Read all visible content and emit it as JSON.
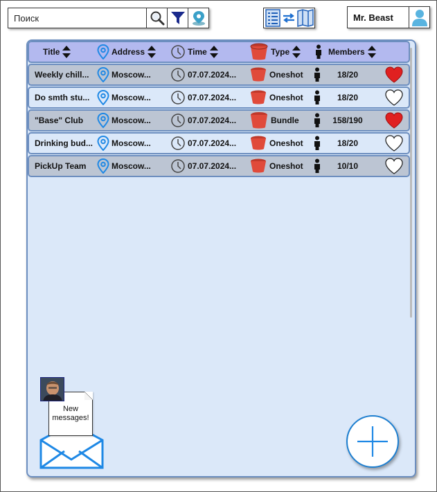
{
  "search": {
    "placeholder": "Поиск"
  },
  "user": {
    "name": "Mr. Beast"
  },
  "table": {
    "headers": {
      "title": "Title",
      "address": "Address",
      "time": "Time",
      "type": "Type",
      "members": "Members"
    },
    "rows": [
      {
        "title": "Weekly chill...",
        "address": "Moscow...",
        "time": "07.07.2024...",
        "type": "Oneshot",
        "members": "18/20",
        "favorite": true
      },
      {
        "title": "Do smth stu...",
        "address": "Moscow...",
        "time": "07.07.2024...",
        "type": "Oneshot",
        "members": "18/20",
        "favorite": false
      },
      {
        "title": "\"Base\" Club",
        "address": "Moscow...",
        "time": "07.07.2024...",
        "type": "Bundle",
        "members": "158/190",
        "favorite": true
      },
      {
        "title": "Drinking bud...",
        "address": "Moscow...",
        "time": "07.07.2024...",
        "type": "Oneshot",
        "members": "18/20",
        "favorite": false
      },
      {
        "title": "PickUp Team",
        "address": "Moscow...",
        "time": "07.07.2024...",
        "type": "Oneshot",
        "members": "10/10",
        "favorite": false
      }
    ]
  },
  "messages": {
    "line1": "New",
    "line2": "messages!"
  },
  "icons": {
    "search": "magnifier-icon",
    "filter": "funnel-icon",
    "location": "map-pin-icon",
    "list_view": "list-view-icon",
    "switch": "swap-arrows-icon",
    "map_view": "map-view-icon",
    "avatar": "user-avatar-icon",
    "sort": "sort-arrows-icon",
    "clock": "clock-icon",
    "type": "bucket-icon",
    "member": "person-icon",
    "heart": "heart-icon",
    "envelope": "envelope-icon",
    "add": "plus-icon"
  },
  "colors": {
    "header_bg": "#b3b9ef",
    "row_gray": "#bcc5d3",
    "row_light": "#dbe8f9",
    "panel_bg": "#dbe8f9",
    "border": "#6c8ebf",
    "accent_blue": "#1e88e5",
    "heart_red": "#e02020",
    "bucket_red": "#e04a3a"
  }
}
